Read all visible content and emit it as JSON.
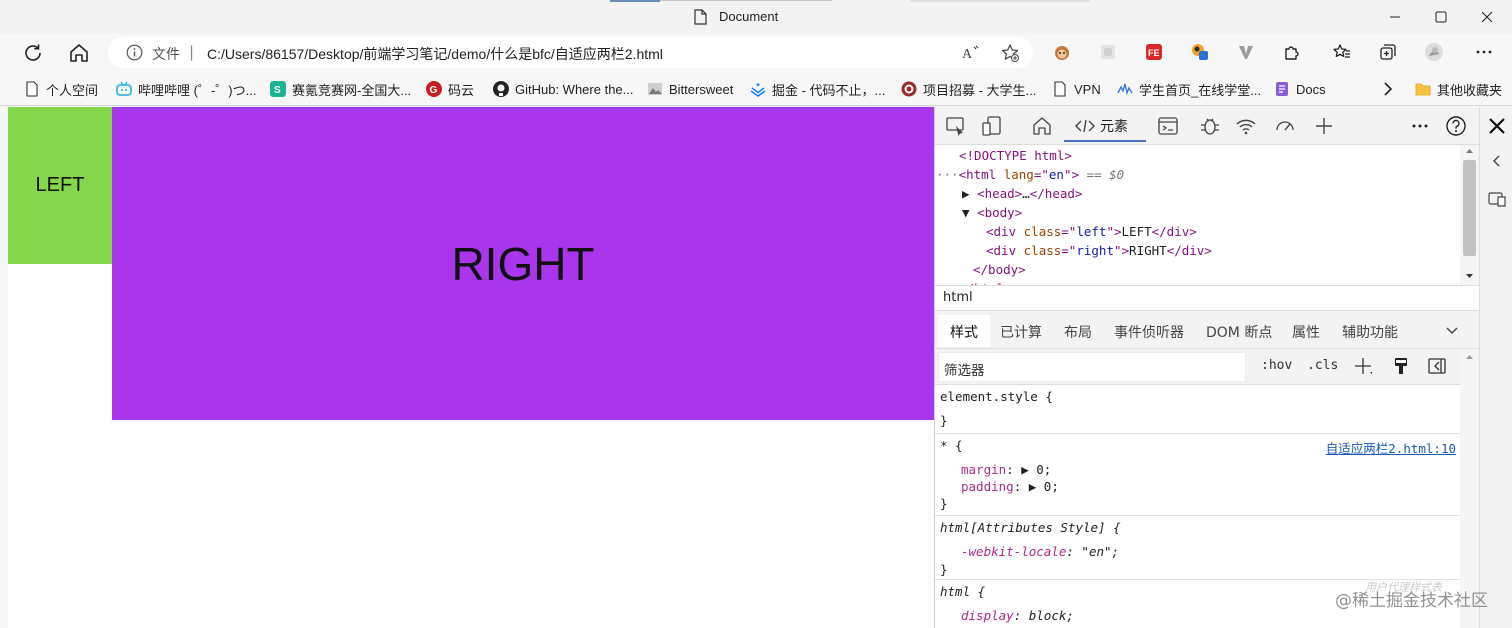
{
  "window": {
    "title": "Document"
  },
  "address_bar": {
    "file_label": "文件",
    "separator": "|",
    "url": "C:/Users/86157/Desktop/前端学习笔记/demo/什么是bfc/自适应两栏2.html"
  },
  "bookmarks": [
    {
      "label": "个人空间",
      "icon": "document-icon",
      "color": "#ffffff"
    },
    {
      "label": "哔哩哔哩 (゜-゜)つ...",
      "icon": "bilibili-icon",
      "color": "#23ade5"
    },
    {
      "label": "赛氪竞赛网-全国大...",
      "icon": "saikr-icon",
      "color": "#1bb394"
    },
    {
      "label": "码云",
      "icon": "gitee-icon",
      "color": "#c71d23"
    },
    {
      "label": "GitHub: Where the...",
      "icon": "github-icon",
      "color": "#222222"
    },
    {
      "label": "Bittersweet",
      "icon": "bittersweet-icon",
      "color": "#888888"
    },
    {
      "label": "掘金 - 代码不止，...",
      "icon": "juejin-icon",
      "color": "#1e80ff"
    },
    {
      "label": "项目招募 - 大学生...",
      "icon": "project-icon",
      "color": "#9c2a2a"
    },
    {
      "label": "VPN",
      "icon": "document-icon",
      "color": "#ffffff"
    },
    {
      "label": "学生首页_在线学堂...",
      "icon": "xuetang-icon",
      "color": "#3a7bd5"
    },
    {
      "label": "Docs",
      "icon": "docs-icon",
      "color": "#8a5cd6"
    }
  ],
  "other_bookmarks": "其他收藏夹",
  "page": {
    "left_text": "LEFT",
    "right_text": "RIGHT",
    "left_color": "#84d64a",
    "right_color": "#a935ec"
  },
  "devtools": {
    "elements_tab": "元素",
    "breadcrumb": "html",
    "style_tabs": [
      "样式",
      "已计算",
      "布局",
      "事件侦听器",
      "DOM 断点",
      "属性",
      "辅助功能"
    ],
    "filter_placeholder": "筛选器",
    "hov": ":hov",
    "cls": ".cls",
    "dom": {
      "doctype": "<!DOCTYPE html>",
      "html_lang": "en",
      "selected_marker": "== $0",
      "div_left_class": "left",
      "div_left_text": "LEFT",
      "div_right_class": "right",
      "div_right_text": "RIGHT"
    },
    "rules": {
      "element_style": "element.style {",
      "universal_selector": "* {",
      "universal_source": "自适应两栏2.html:10",
      "margin_name": "margin",
      "margin_value": "0;",
      "padding_name": "padding",
      "padding_value": "0;",
      "html_attr_selector": "html[Attributes Style] {",
      "locale_name": "-webkit-locale",
      "locale_value": "\"en\";",
      "html_selector": "html {",
      "display_name": "display",
      "display_value": "block;"
    }
  },
  "watermark": "@稀土掘金技术社区",
  "watermark_faint": "用户代理样式表"
}
